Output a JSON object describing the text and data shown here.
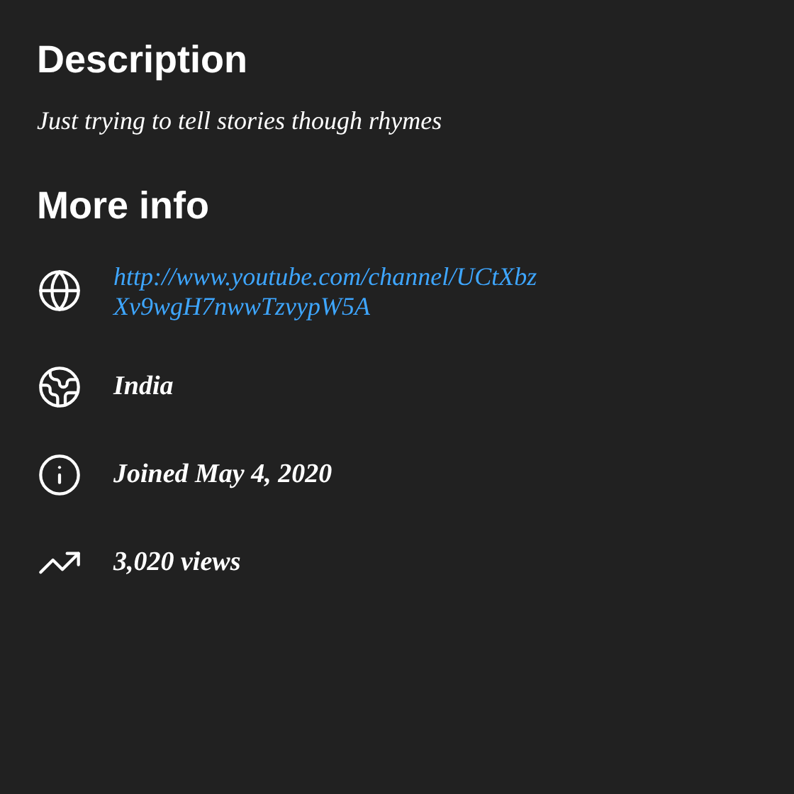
{
  "description": {
    "heading": "Description",
    "text": "Just trying to tell stories though rhymes"
  },
  "more_info": {
    "heading": "More info",
    "items": [
      {
        "kind": "link",
        "text": "http://www.youtube.com/channel/UCtXbzXv9wgH7nwwTzvypW5A"
      },
      {
        "kind": "country",
        "text": "India"
      },
      {
        "kind": "joined",
        "text": "Joined May 4, 2020"
      },
      {
        "kind": "views",
        "text": "3,020 views"
      }
    ]
  }
}
